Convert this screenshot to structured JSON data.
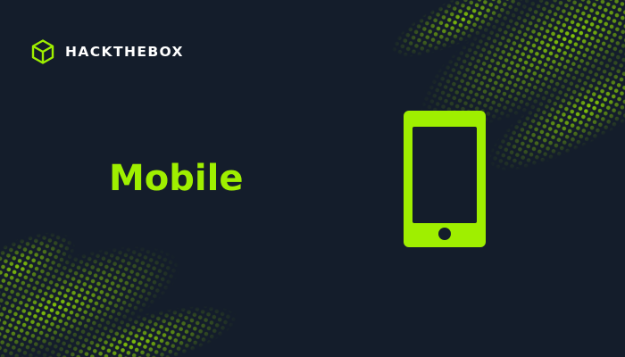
{
  "brand": {
    "name_parts": [
      "HACK",
      "THE",
      "BOX"
    ],
    "logo_icon": "hexagon-cube-icon"
  },
  "headline": "Mobile",
  "illustration": {
    "icon": "smartphone-icon"
  },
  "colors": {
    "background": "#141d2b",
    "accent": "#9fef00",
    "text": "#ffffff"
  }
}
